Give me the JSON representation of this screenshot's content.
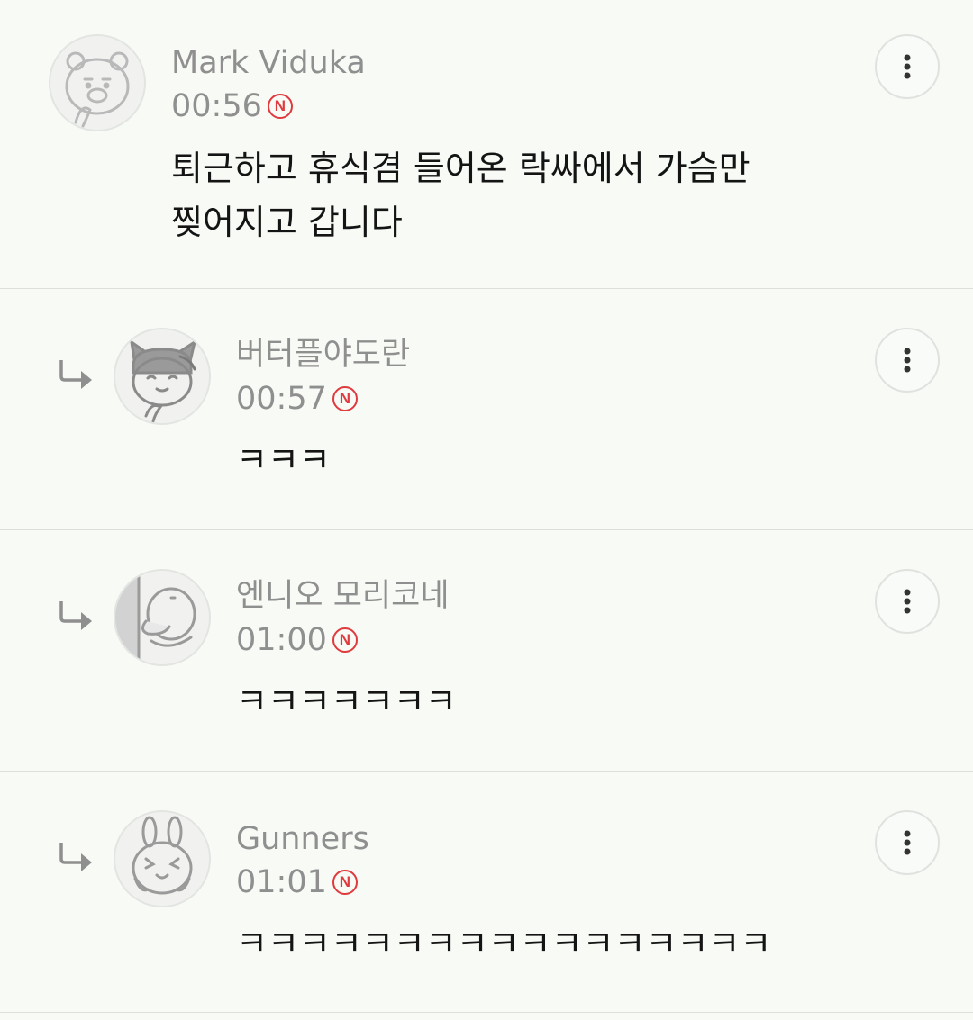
{
  "comments": [
    {
      "author": "Mark Viduka",
      "time": "00:56",
      "new_badge": "N",
      "text": "퇴근하고 휴식겸 들어온 락싸에서 가슴만\n찢어지고 갑니다",
      "is_reply": false,
      "avatar_icon": "ryan-bear-avatar-icon"
    },
    {
      "author": "버터플야도란",
      "time": "00:57",
      "new_badge": "N",
      "text": "ㅋㅋㅋ",
      "is_reply": true,
      "avatar_icon": "cat-avatar-icon"
    },
    {
      "author": "엔니오 모리코네",
      "time": "01:00",
      "new_badge": "N",
      "text": "ㅋㅋㅋㅋㅋㅋㅋ",
      "is_reply": true,
      "avatar_icon": "duck-avatar-icon"
    },
    {
      "author": "Gunners",
      "time": "01:01",
      "new_badge": "N",
      "text": "ㅋㅋㅋㅋㅋㅋㅋㅋㅋㅋㅋㅋㅋㅋㅋㅋㅋ",
      "is_reply": true,
      "avatar_icon": "rabbit-avatar-icon"
    }
  ],
  "colors": {
    "background": "#f7faf5",
    "author_text": "#8f8f8f",
    "body_text": "#141414",
    "new_badge": "#e0393e",
    "divider": "#dcdfdb"
  }
}
